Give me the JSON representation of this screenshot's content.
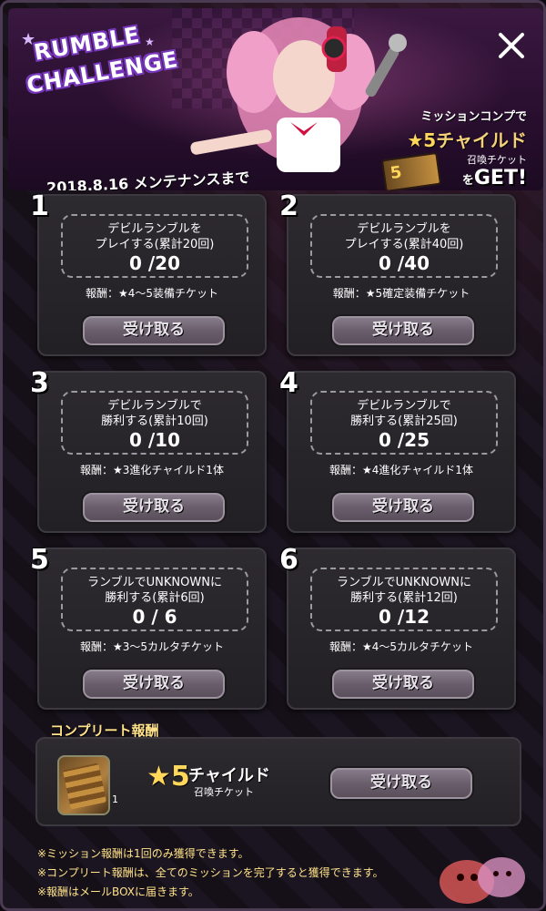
{
  "banner": {
    "logo_line1": "RUMBLE",
    "logo_line2": "CHALLENGE",
    "promo_line1": "ミッションコンプで",
    "promo_star": "★5",
    "promo_line2": "チャイルド",
    "promo_line3": "召喚チケット",
    "promo_line4_a": "を",
    "promo_line4_b": "GET!",
    "ticket_label": "5",
    "deadline": "2018.8.16 メンテナンスまで"
  },
  "missions": [
    {
      "num": "1",
      "t1": "デビルランブルを",
      "t2": "プレイする(累計20回)",
      "progress": "0 /20",
      "reward": "報酬：★4〜5装備チケット",
      "button": "受け取る"
    },
    {
      "num": "2",
      "t1": "デビルランブルを",
      "t2": "プレイする(累計40回)",
      "progress": "0 /40",
      "reward": "報酬：★5確定装備チケット",
      "button": "受け取る"
    },
    {
      "num": "3",
      "t1": "デビルランブルで",
      "t2": "勝利する(累計10回)",
      "progress": "0 /10",
      "reward": "報酬：★3進化チャイルド1体",
      "button": "受け取る"
    },
    {
      "num": "4",
      "t1": "デビルランブルで",
      "t2": "勝利する(累計25回)",
      "progress": "0 /25",
      "reward": "報酬：★4進化チャイルド1体",
      "button": "受け取る"
    },
    {
      "num": "5",
      "t1": "ランブルでUNKNOWNに",
      "t2": "勝利する(累計6回)",
      "progress": "0 / 6",
      "reward": "報酬：★3〜5カルタチケット",
      "button": "受け取る"
    },
    {
      "num": "6",
      "t1": "ランブルでUNKNOWNに",
      "t2": "勝利する(累計12回)",
      "progress": "0 /12",
      "reward": "報酬：★4〜5カルタチケット",
      "button": "受け取る"
    }
  ],
  "complete": {
    "label": "コンプリート報酬",
    "item_count": "1",
    "item_star": "★5",
    "item_name": "チャイルド",
    "item_sub": "召喚チケット",
    "button": "受け取る"
  },
  "notes": [
    "※ミッション報酬は1回のみ獲得できます。",
    "※コンプリート報酬は、全てのミッションを完了すると獲得できます。",
    "※報酬はメールBOXに届きます。"
  ]
}
